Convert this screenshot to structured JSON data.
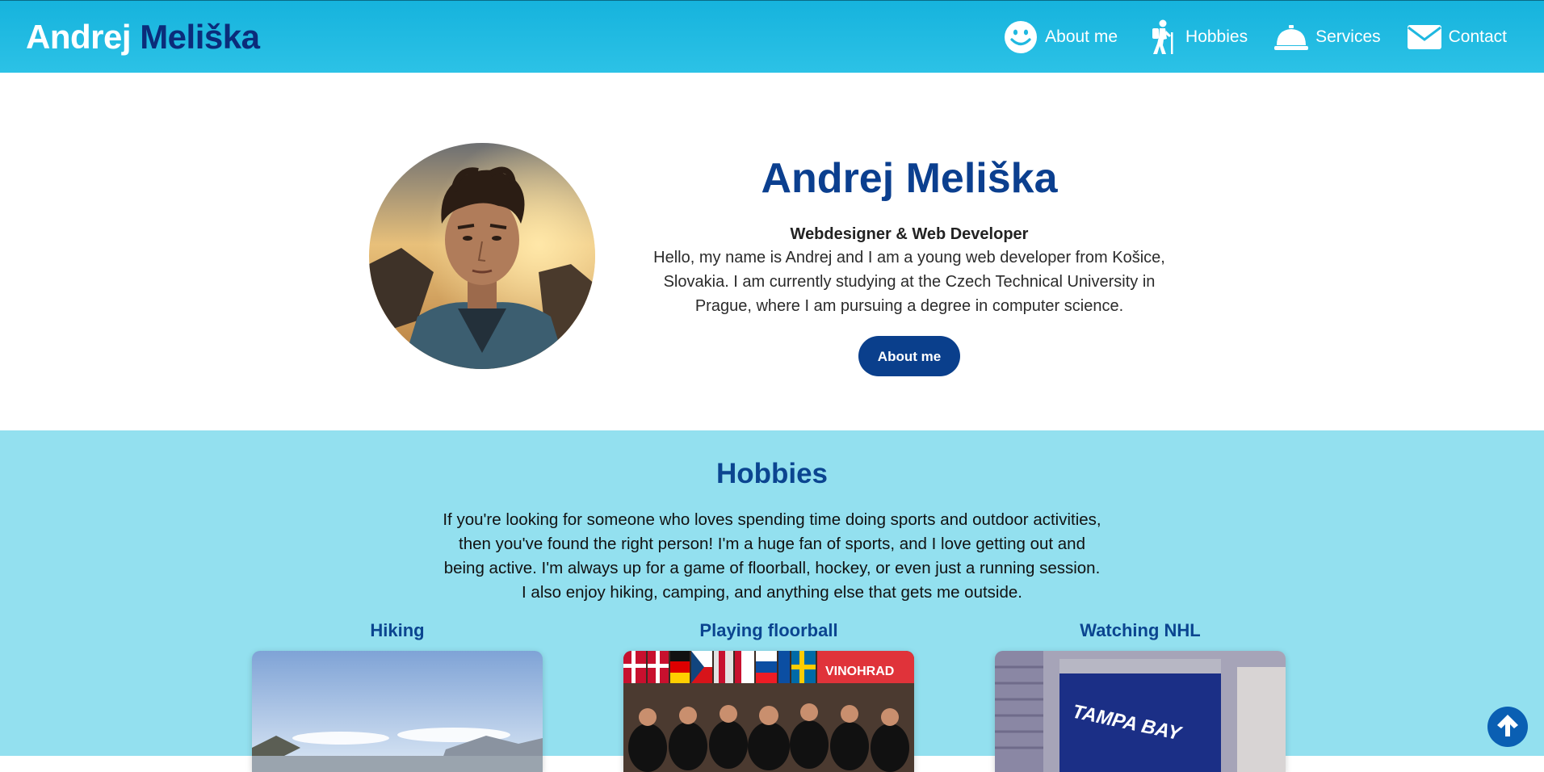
{
  "header": {
    "brand_first": "Andrej",
    "brand_last": "Meliška",
    "nav": [
      {
        "label": "About me",
        "icon": "smiley-icon"
      },
      {
        "label": "Hobbies",
        "icon": "hiker-icon"
      },
      {
        "label": "Services",
        "icon": "service-bell-icon"
      },
      {
        "label": "Contact",
        "icon": "envelope-icon"
      }
    ]
  },
  "hero": {
    "title": "Andrej Meliška",
    "subtitle": "Webdesigner & Web Developer",
    "description": "Hello, my name is Andrej and I am a young web developer from Košice, Slovakia. I am currently studying at the Czech Technical University in Prague, where I am pursuing a degree in computer science.",
    "button_label": "About me"
  },
  "hobbies": {
    "title": "Hobbies",
    "description": "If you're looking for someone who loves spending time doing sports and outdoor activities, then you've found the right person! I'm a huge fan of sports, and I love getting out and being active. I'm always up for a game of floorball, hockey, or even just a running session. I also enjoy hiking, camping, and anything else that gets me outside.",
    "cards": [
      {
        "title": "Hiking"
      },
      {
        "title": "Playing floorball"
      },
      {
        "title": "Watching NHL"
      }
    ],
    "floorball_banner": "VINOHRAD",
    "nhl_banner": "TAMPA BAY"
  },
  "colors": {
    "header_gradient_top": "#16b3dd",
    "brand_dark": "#0b2c7a",
    "accent_blue": "#0a3f8c",
    "hobbies_bg": "#93e0ef"
  }
}
